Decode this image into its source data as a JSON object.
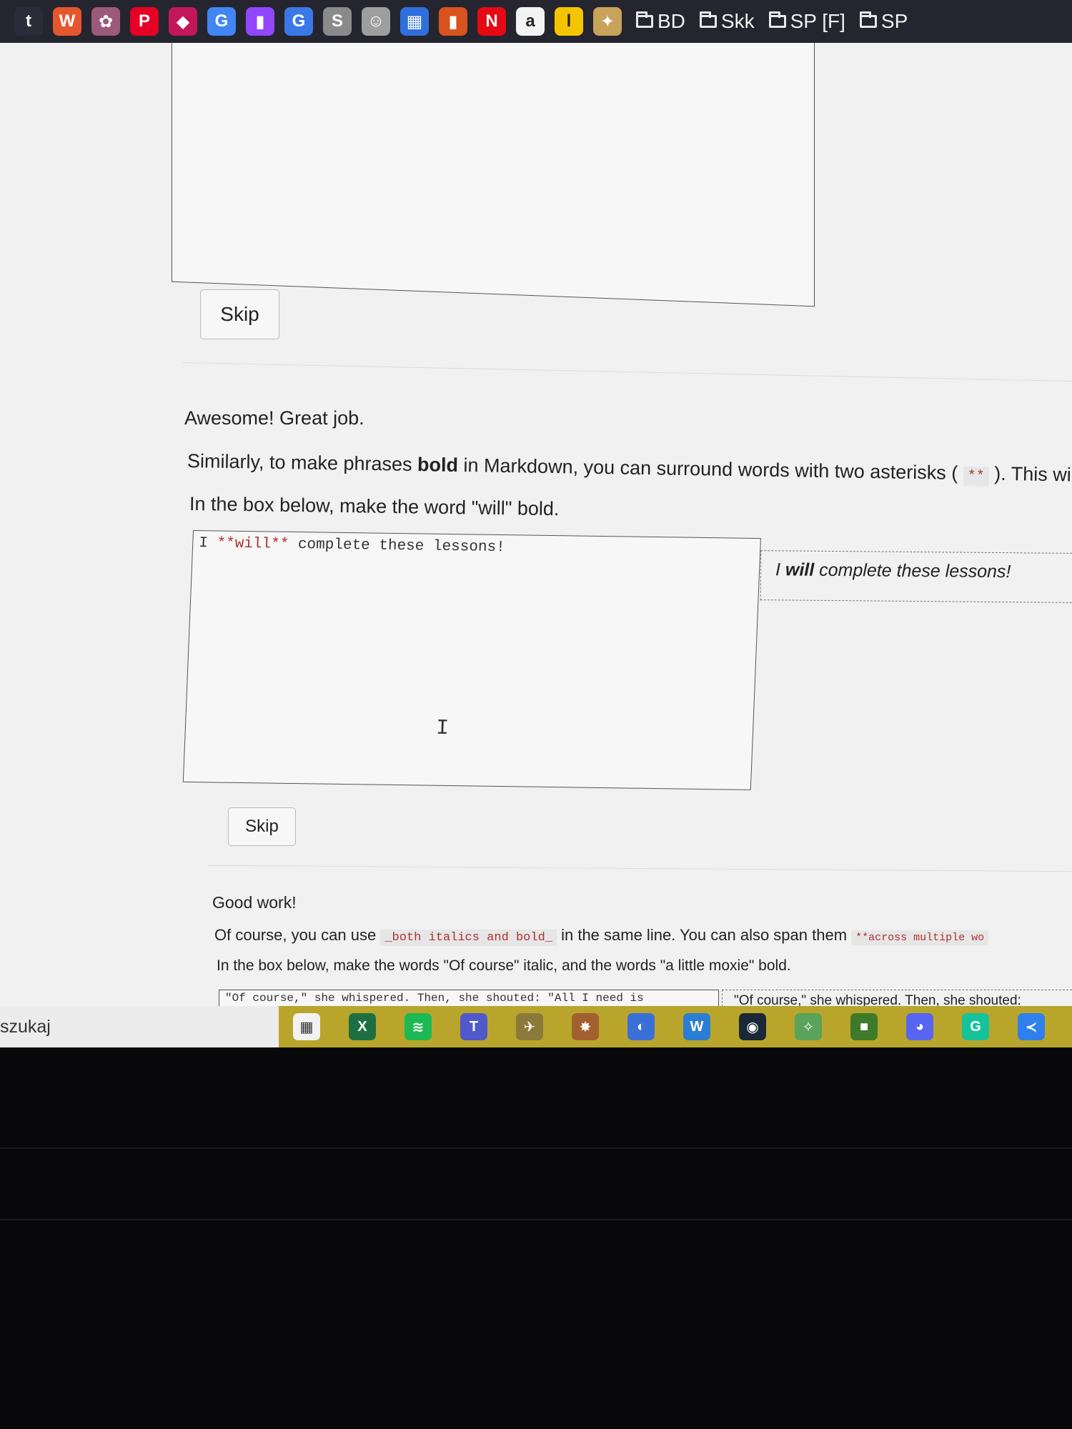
{
  "bookmarks": {
    "icons": [
      {
        "name": "tumblr-icon",
        "glyph": "t",
        "color": "#2b2b39"
      },
      {
        "name": "w-icon",
        "glyph": "W",
        "color": "#e4572e"
      },
      {
        "name": "anime-icon",
        "glyph": "✿",
        "color": "#9c5a7a"
      },
      {
        "name": "pinterest-icon",
        "glyph": "P",
        "color": "#e60023"
      },
      {
        "name": "shield-icon",
        "glyph": "◆",
        "color": "#c2185b"
      },
      {
        "name": "google-icon",
        "glyph": "G",
        "color": "#4285f4"
      },
      {
        "name": "twitch-icon",
        "glyph": "▮",
        "color": "#9146ff"
      },
      {
        "name": "translate-icon",
        "glyph": "G",
        "color": "#3b78e7"
      },
      {
        "name": "s-icon",
        "glyph": "S",
        "color": "#8a8a8a"
      },
      {
        "name": "clock-icon",
        "glyph": "☺",
        "color": "#9e9e9e"
      },
      {
        "name": "calendar-icon",
        "glyph": "▦",
        "color": "#2f6fdb"
      },
      {
        "name": "jar-icon",
        "glyph": "▮",
        "color": "#d9531e"
      },
      {
        "name": "netflix-icon",
        "glyph": "N",
        "color": "#e50914"
      },
      {
        "name": "amazon-icon",
        "glyph": "a",
        "color": "#f3f3f3"
      },
      {
        "name": "l-icon",
        "glyph": "l",
        "color": "#f5c400"
      },
      {
        "name": "fox-icon",
        "glyph": "✦",
        "color": "#c9a25c"
      }
    ],
    "folders": [
      "BD",
      "Skk",
      "SP [F]",
      "SP"
    ]
  },
  "page": {
    "first_skip": "Skip",
    "awesome": "Awesome! Great job.",
    "bold_intro_before": "Similarly, to make phrases ",
    "bold_word": "bold",
    "bold_intro_after": " in Markdown, you can surround words with two asterisks ( ",
    "bold_code": "**",
    "bold_intro_end": " ). This wi",
    "instruction_1": "In the box below, make the word \"will\" bold.",
    "textarea_1": {
      "prefix": "I ",
      "bold_markdown": "**will**",
      "suffix": " complete these lessons!"
    },
    "preview_1": {
      "before": "I ",
      "bold": "will",
      "after": " complete these lessons!"
    },
    "second_skip": "Skip",
    "good_work": "Good work!",
    "of_course_before": "Of course, you can use ",
    "of_course_code": "_both italics and bold_",
    "of_course_middle": " in the same line. You can also span them ",
    "of_course_code_2": "**across multiple wo",
    "instruction_2": "In the box below, make the words \"Of course\" italic, and the words \"a little moxie\" bold.",
    "textarea_2": "\"Of course,\" she whispered. Then, she shouted: \"All I need is",
    "preview_2": "\"Of course,\" she whispered. Then, she shouted:"
  },
  "taskbar": {
    "search_text": "szukaj",
    "icons": [
      {
        "name": "store-icon",
        "glyph": "▦",
        "color": "#f2f2f2"
      },
      {
        "name": "excel-icon",
        "glyph": "X",
        "color": "#1d6f42"
      },
      {
        "name": "spotify-icon",
        "glyph": "≋",
        "color": "#1db954"
      },
      {
        "name": "teams-icon",
        "glyph": "T",
        "color": "#5059c9"
      },
      {
        "name": "bird-icon",
        "glyph": "✈",
        "color": "#8c7a3a"
      },
      {
        "name": "game-icon",
        "glyph": "✸",
        "color": "#a06030"
      },
      {
        "name": "app-icon",
        "glyph": "◐",
        "color": "#3a6fd8"
      },
      {
        "name": "word-icon",
        "glyph": "W",
        "color": "#2b7cd3"
      },
      {
        "name": "steam-icon",
        "glyph": "◉",
        "color": "#1b2838"
      },
      {
        "name": "leaf-icon",
        "glyph": "✧",
        "color": "#5aa35a"
      },
      {
        "name": "minecraft-icon",
        "glyph": "■",
        "color": "#3f7a2a"
      },
      {
        "name": "discord-icon",
        "glyph": "◕",
        "color": "#5865f2"
      },
      {
        "name": "grammarly-icon",
        "glyph": "G",
        "color": "#15c39a"
      },
      {
        "name": "vscode-icon",
        "glyph": "≺",
        "color": "#2f80ed"
      }
    ]
  }
}
